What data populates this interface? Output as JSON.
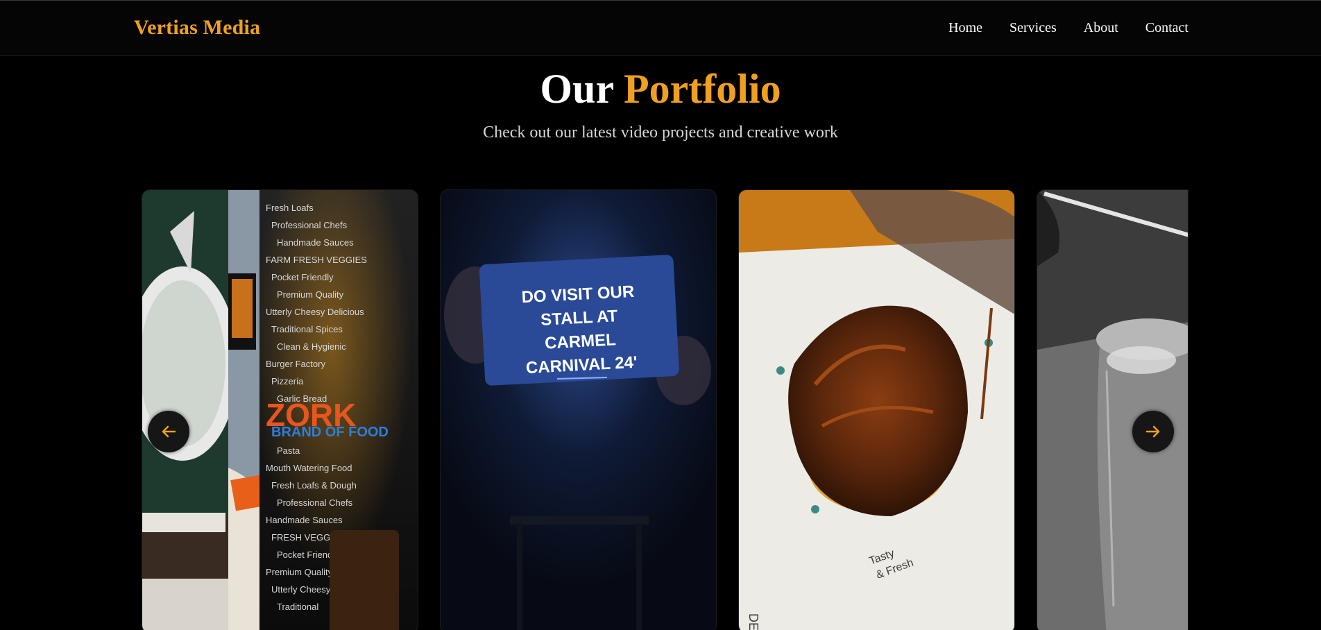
{
  "brand": "Vertias Media",
  "nav": [
    {
      "label": "Home"
    },
    {
      "label": "Services"
    },
    {
      "label": "About"
    },
    {
      "label": "Contact"
    }
  ],
  "portfolio": {
    "title_plain": "Our",
    "title_accent": "Portfolio",
    "subtitle": "Check out our latest video projects and creative work"
  },
  "cards": [
    {
      "name": "restaurant wall video",
      "wall_text": [
        "Fresh Loafs",
        "Professional Chefs",
        "Handmade Sauces",
        "FARM FRESH VEGGIES",
        "Pocket Friendly",
        "Premium Quality",
        "Utterly Cheesy Delicious",
        "Traditional Spices",
        "Clean & Hygienic",
        "Burger Factory",
        "Pizzeria",
        "Garlic Bread",
        "ZORK",
        "BRAND OF FOOD",
        "Pasta",
        "Mouth Watering Food",
        "Fresh Loafs & Dough",
        "Professional Chefs",
        "Handmade Sauces",
        "FRESH VEGGIES",
        "Pocket Friendly",
        "Premium Quality",
        "Utterly Cheesy",
        "Traditional"
      ]
    },
    {
      "name": "carnival sign video",
      "sign_text": [
        "DO VISIT OUR",
        "STALL AT",
        "CARMEL",
        "CARNIVAL 24'"
      ]
    },
    {
      "name": "fried chicken video",
      "paper_text": [
        "Tasty",
        "& Fresh",
        "DELI"
      ]
    },
    {
      "name": "cold drink video"
    }
  ],
  "controls": {
    "prev_icon": "arrow-left-icon",
    "next_icon": "arrow-right-icon"
  },
  "colors": {
    "accent": "#f0a020",
    "background": "#000000",
    "nav_background": "#050505"
  }
}
